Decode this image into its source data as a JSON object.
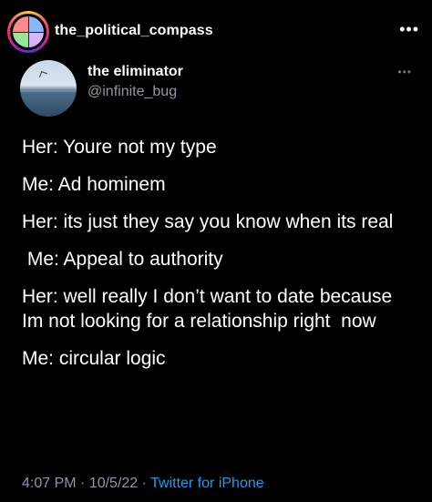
{
  "post": {
    "account": "the_political_compass",
    "more": "•••"
  },
  "tweet": {
    "display_name": "the eliminator",
    "handle": "@infinite_bug",
    "more": "•••",
    "lines": [
      "Her: Youre not my type",
      "Me: Ad hominem",
      "Her: its just they say you know when its real",
      " Me: Appeal to authority",
      "Her: well really I don’t want to date because Im not looking for a relationship right  now",
      "Me: circular logic"
    ],
    "time": "4:07 PM",
    "separator_1": " · ",
    "date": "10/5/22",
    "separator_2": " · ",
    "source": "Twitter for iPhone"
  }
}
